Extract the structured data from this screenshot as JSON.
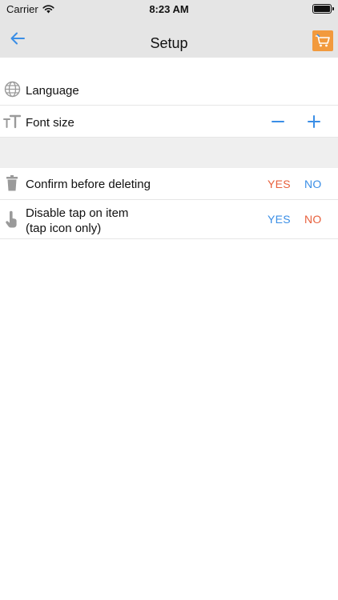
{
  "status_bar": {
    "carrier": "Carrier",
    "time": "8:23 AM"
  },
  "nav": {
    "title": "Setup",
    "back_icon": "arrow-left-icon",
    "cart_icon": "cart-icon"
  },
  "settings": {
    "language": {
      "label": "Language",
      "icon": "globe-icon"
    },
    "font_size": {
      "label": "Font size",
      "icon": "text-size-icon",
      "decrease": "−",
      "increase": "+"
    },
    "confirm_delete": {
      "label": "Confirm before deleting",
      "icon": "trash-icon",
      "yes": "YES",
      "no": "NO"
    },
    "disable_tap": {
      "label": "Disable tap on item",
      "sublabel": "(tap icon only)",
      "icon": "tap-hand-icon",
      "yes": "YES",
      "no": "NO"
    }
  },
  "colors": {
    "accent_blue": "#3a8ee6",
    "accent_red": "#e8603c",
    "cart_orange": "#f29a3d",
    "bar_gray": "#e5e5e5"
  }
}
